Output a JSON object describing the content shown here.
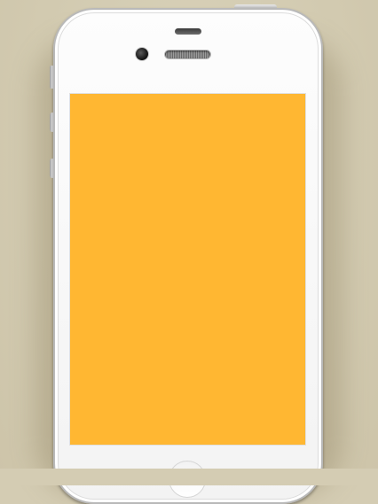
{
  "device": {
    "model": "iPhone",
    "color": "white",
    "frame_color": "#f5f5f5",
    "screen_color": "#ffb732",
    "background_color": "#d4ccb3"
  }
}
